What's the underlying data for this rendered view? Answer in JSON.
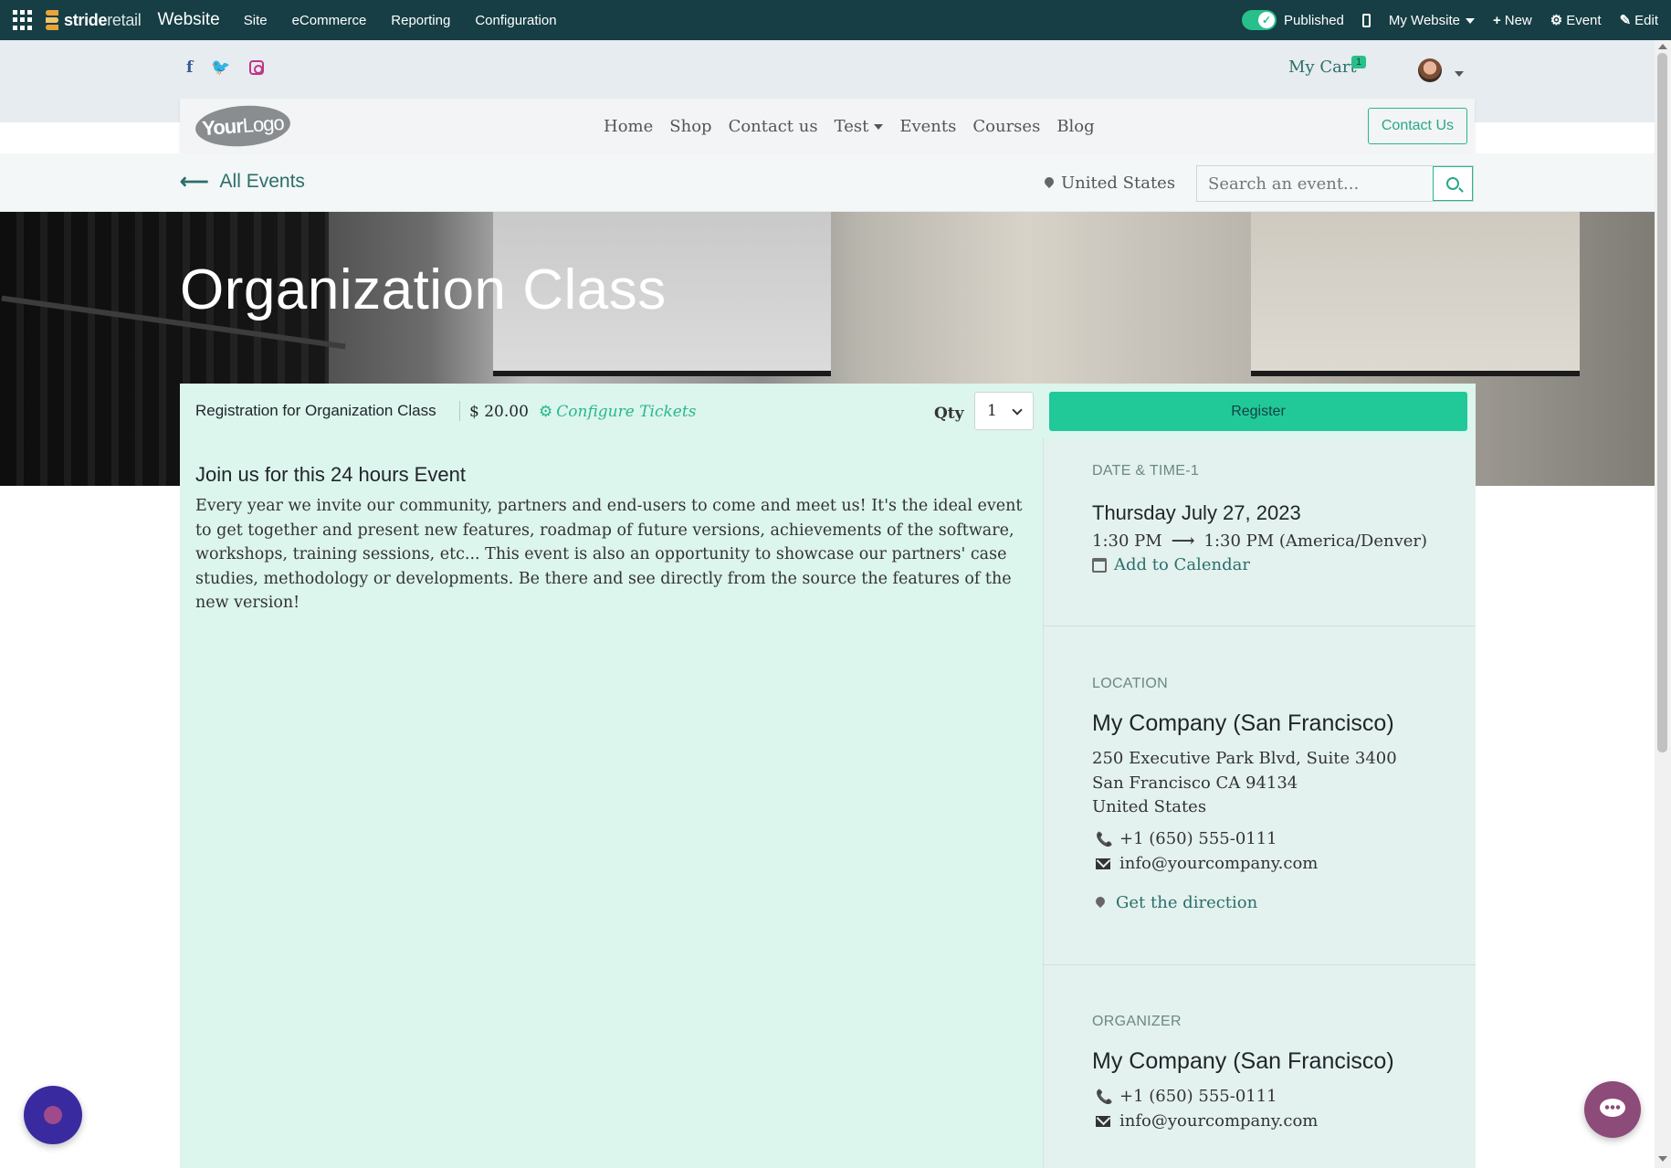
{
  "admin_bar": {
    "brand_bold": "stride",
    "brand_light": "retail",
    "app_title": "Website",
    "menu": [
      "Site",
      "eCommerce",
      "Reporting",
      "Configuration"
    ],
    "published_label": "Published",
    "website_label": "My Website",
    "new_label": "New",
    "event_label": "Event",
    "edit_label": "Edit"
  },
  "header": {
    "cart_label": "My Cart",
    "cart_count": "1",
    "logo_bold": "Your",
    "logo_light": "Logo",
    "nav": [
      "Home",
      "Shop",
      "Contact us",
      "Test",
      "Events",
      "Courses",
      "Blog"
    ],
    "contact_button": "Contact Us"
  },
  "subbar": {
    "all_events": "All Events",
    "country": "United States",
    "search_placeholder": "Search an event..."
  },
  "event": {
    "title": "Organization Class",
    "registration_label": "Registration for Organization Class",
    "price": "$ 20.00",
    "configure_tickets": "Configure Tickets",
    "qty_label": "Qty",
    "qty_value": "1",
    "register_button": "Register",
    "description_title": "Join us for this 24 hours Event",
    "description": "Every year we invite our community, partners and end-users to come and meet us! It's the ideal event to get together and present new features, roadmap of future versions, achievements of the software, workshops, training sessions, etc... This event is also an opportunity to showcase our partners' case studies, methodology or developments. Be there and see directly from the source the features of the new version!"
  },
  "sidebar": {
    "date_heading": "DATE & TIME-1",
    "date": "Thursday July 27, 2023",
    "time_start": "1:30 PM",
    "time_end": "1:30 PM (America/Denver)",
    "add_to_calendar": "Add to Calendar",
    "location_heading": "LOCATION",
    "location_name": "My Company (San Francisco)",
    "address_line1": "250 Executive Park Blvd, Suite 3400",
    "address_line2": "San Francisco CA 94134",
    "address_line3": "United States",
    "location_phone": "+1 (650) 555-0111",
    "location_email": "info@yourcompany.com",
    "get_direction": "Get the direction",
    "organizer_heading": "ORGANIZER",
    "organizer_name": "My Company (San Francisco)",
    "organizer_phone": "+1 (650) 555-0111",
    "organizer_email": "info@yourcompany.com"
  },
  "colors": {
    "admin_bar": "#163e44",
    "accent": "#20c997",
    "panel": "#dcf5ed"
  },
  "icons": [
    "apps-grid-icon",
    "facebook-icon",
    "twitter-icon",
    "instagram-icon",
    "search-icon",
    "map-pin-icon",
    "gear-icon",
    "calendar-icon",
    "phone-icon",
    "envelope-icon",
    "chat-icon"
  ]
}
